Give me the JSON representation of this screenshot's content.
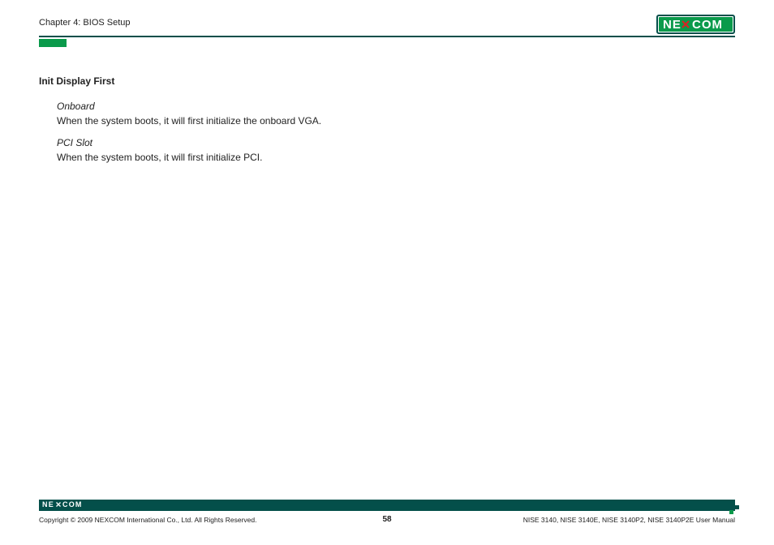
{
  "header": {
    "chapter": "Chapter 4: BIOS Setup"
  },
  "brand": {
    "name": "NE COM",
    "x_char": "x"
  },
  "content": {
    "section_title": "Init Display First",
    "options": [
      {
        "name": "Onboard",
        "desc": "When the system boots, it will first initialize the onboard VGA."
      },
      {
        "name": "PCI Slot",
        "desc": "When the system boots, it will first initialize PCI."
      }
    ]
  },
  "footer": {
    "copyright": "Copyright © 2009 NEXCOM International Co., Ltd. All Rights Reserved.",
    "page_number": "58",
    "manual_name": "NISE 3140, NISE 3140E, NISE 3140P2, NISE 3140P2E User Manual"
  }
}
